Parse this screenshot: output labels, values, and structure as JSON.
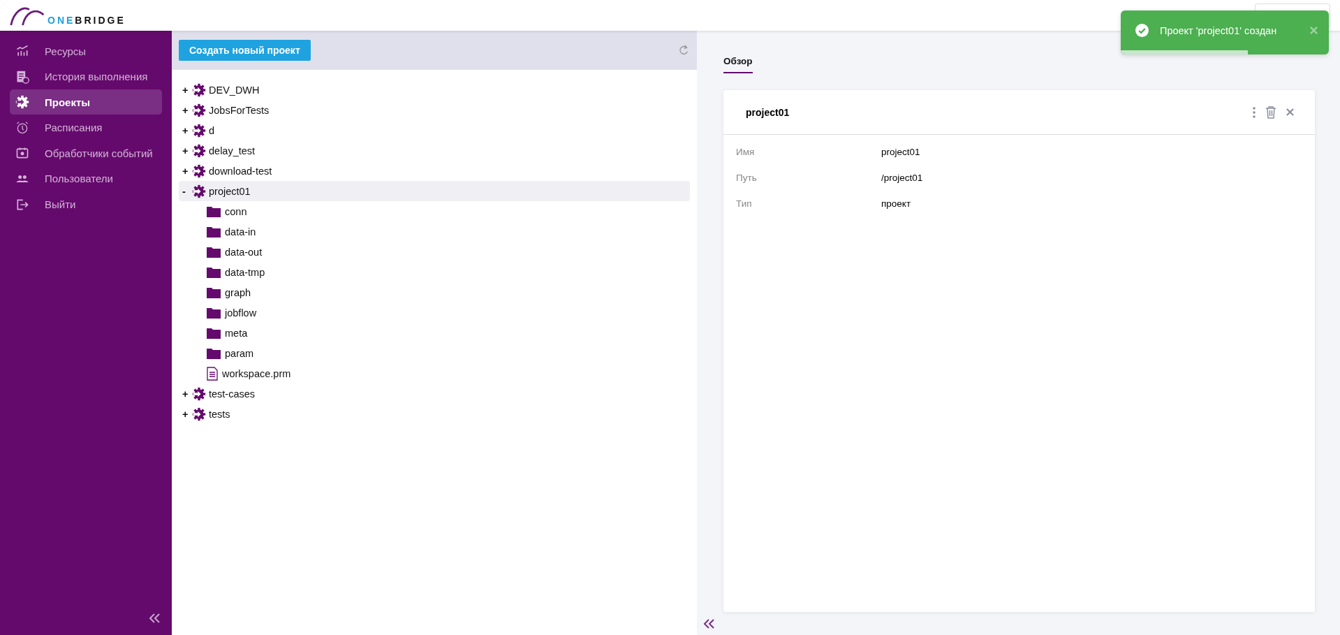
{
  "header": {
    "logo": {
      "accent": "ONE",
      "rest": "BRIDGE"
    }
  },
  "sidebar": {
    "items": [
      {
        "label": "Ресурсы",
        "kind": "chart",
        "selected": false
      },
      {
        "label": "История выполнения",
        "kind": "history",
        "selected": false
      },
      {
        "label": "Проекты",
        "kind": "projects",
        "selected": true
      },
      {
        "label": "Расписания",
        "kind": "clock",
        "selected": false
      },
      {
        "label": "Обработчики событий",
        "kind": "calendar",
        "selected": false
      },
      {
        "label": "Пользователи",
        "kind": "users",
        "selected": false
      },
      {
        "label": "Выйти",
        "kind": "logout",
        "selected": false
      }
    ]
  },
  "tree_panel": {
    "create_button": "Создать новый проект",
    "tree": [
      {
        "label": "DEV_DWH",
        "kind": "project",
        "toggle": "+",
        "selected": false
      },
      {
        "label": "JobsForTests",
        "kind": "project",
        "toggle": "+",
        "selected": false
      },
      {
        "label": "d",
        "kind": "project",
        "toggle": "+",
        "selected": false
      },
      {
        "label": "delay_test",
        "kind": "project",
        "toggle": "+",
        "selected": false
      },
      {
        "label": "download-test",
        "kind": "project",
        "toggle": "+",
        "selected": false
      },
      {
        "label": "project01",
        "kind": "project",
        "toggle": "-",
        "selected": true,
        "children": [
          {
            "label": "conn",
            "kind": "folder",
            "selected": false
          },
          {
            "label": "data-in",
            "kind": "folder",
            "selected": false
          },
          {
            "label": "data-out",
            "kind": "folder",
            "selected": false
          },
          {
            "label": "data-tmp",
            "kind": "folder",
            "selected": false
          },
          {
            "label": "graph",
            "kind": "folder",
            "selected": false
          },
          {
            "label": "jobflow",
            "kind": "folder",
            "selected": false
          },
          {
            "label": "meta",
            "kind": "folder",
            "selected": false
          },
          {
            "label": "param",
            "kind": "folder",
            "selected": false
          },
          {
            "label": "workspace.prm",
            "kind": "file",
            "selected": false
          }
        ]
      },
      {
        "label": "test-cases",
        "kind": "project",
        "toggle": "+",
        "selected": false
      },
      {
        "label": "tests",
        "kind": "project",
        "toggle": "+",
        "selected": false
      }
    ]
  },
  "detail": {
    "tabs": [
      {
        "label": "Обзор",
        "selected": true
      }
    ],
    "card": {
      "title": "project01",
      "properties": [
        {
          "name": "Имя",
          "value": "project01"
        },
        {
          "name": "Путь",
          "value": "/project01"
        },
        {
          "name": "Тип",
          "value": "проект"
        }
      ]
    }
  },
  "toast": {
    "message": "Проект 'project01' создан",
    "level": 0.61
  }
}
